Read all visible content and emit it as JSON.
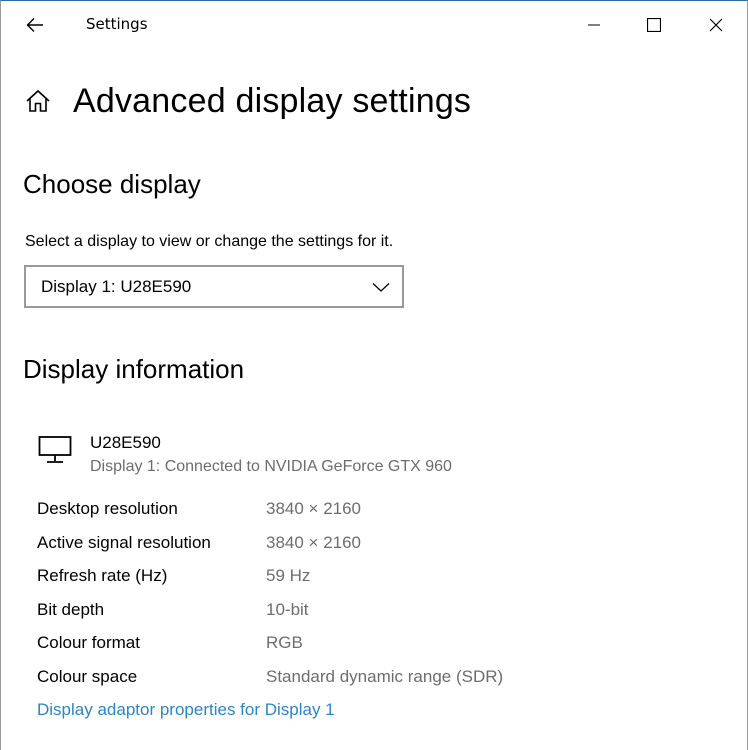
{
  "window": {
    "app_title": "Settings",
    "controls": {
      "minimize": "minimize-icon",
      "maximize": "maximize-icon",
      "close": "close-icon"
    },
    "back_icon": "back-arrow-icon"
  },
  "header": {
    "icon": "home-icon",
    "title": "Advanced display settings"
  },
  "choose_display": {
    "section_title": "Choose display",
    "instruction": "Select a display to view or change the settings for it.",
    "dropdown": {
      "selected": "Display 1: U28E590",
      "icon": "chevron-down-icon"
    }
  },
  "display_information": {
    "section_title": "Display information",
    "monitor": {
      "icon": "monitor-icon",
      "name": "U28E590",
      "description": "Display 1: Connected to NVIDIA GeForce GTX 960"
    },
    "rows": [
      {
        "label": "Desktop resolution",
        "value": "3840 × 2160"
      },
      {
        "label": "Active signal resolution",
        "value": "3840 × 2160"
      },
      {
        "label": "Refresh rate (Hz)",
        "value": "59 Hz"
      },
      {
        "label": "Bit depth",
        "value": "10-bit"
      },
      {
        "label": "Colour format",
        "value": "RGB"
      },
      {
        "label": "Colour space",
        "value": "Standard dynamic range (SDR)"
      }
    ],
    "link": "Display adaptor properties for Display 1"
  },
  "colors": {
    "accent_link": "#2a86c8",
    "secondary_text": "#6d6d6d",
    "dropdown_border": "#999999"
  }
}
